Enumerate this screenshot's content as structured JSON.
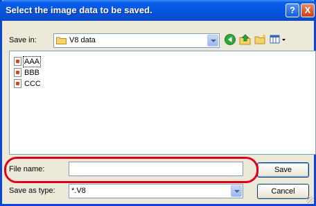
{
  "window": {
    "title": "Select the image data to be saved.",
    "help_label": "?",
    "close_label": "X"
  },
  "save_in": {
    "label": "Save in:",
    "value": "V8 data",
    "icons": [
      "back-icon",
      "up-folder-icon",
      "new-folder-icon",
      "views-menu-icon"
    ]
  },
  "files": [
    {
      "name": "AAA",
      "focused": true
    },
    {
      "name": "BBB",
      "focused": false
    },
    {
      "name": "CCC",
      "focused": false
    }
  ],
  "file_name": {
    "label": "File name:",
    "value": ""
  },
  "save_as_type": {
    "label": "Save as type:",
    "value": "*.V8"
  },
  "buttons": {
    "save": "Save",
    "cancel": "Cancel"
  },
  "colors": {
    "title_bar": "#0655e0",
    "highlight": "#e0001a"
  }
}
